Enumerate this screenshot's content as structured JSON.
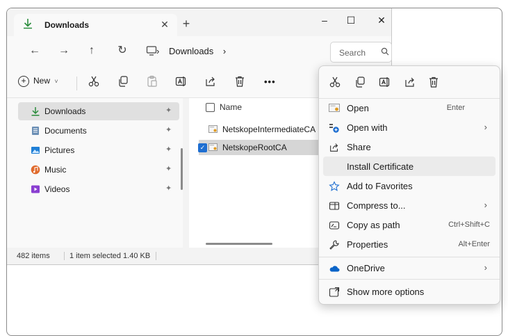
{
  "tab": {
    "title": "Downloads",
    "close": "✕",
    "new_tab": "+"
  },
  "window": {
    "minimize": "–",
    "maximize": "☐",
    "close": "✕"
  },
  "address": {
    "back": "←",
    "forward": "→",
    "up": "↑",
    "refresh": "↻",
    "crumb_sep": "›",
    "crumb_1": "Downloads",
    "crumb_2": "›",
    "search_placeholder": "Search"
  },
  "toolbar": {
    "new_label": "New",
    "new_chevron": "˅",
    "more": "•••"
  },
  "sidebar": {
    "items": [
      {
        "label": "Downloads"
      },
      {
        "label": "Documents"
      },
      {
        "label": "Pictures"
      },
      {
        "label": "Music"
      },
      {
        "label": "Videos"
      }
    ],
    "pin": "✦"
  },
  "content": {
    "column_name": "Name",
    "files": [
      {
        "name": "NetskopeIntermediateCA"
      },
      {
        "name": "NetskopeRootCA"
      }
    ]
  },
  "status": {
    "count": "482 items",
    "selection": "1 item selected  1.40 KB"
  },
  "context_menu": {
    "items": [
      {
        "label": "Open",
        "shortcut": "Enter"
      },
      {
        "label": "Open with",
        "arrow": "›"
      },
      {
        "label": "Share"
      },
      {
        "label": "Install Certificate"
      },
      {
        "label": "Add to Favorites"
      },
      {
        "label": "Compress to...",
        "arrow": "›"
      },
      {
        "label": "Copy as path",
        "shortcut": "Ctrl+Shift+C"
      },
      {
        "label": "Properties",
        "shortcut": "Alt+Enter"
      },
      {
        "label": "OneDrive",
        "arrow": "›"
      },
      {
        "label": "Show more options"
      }
    ]
  },
  "colors": {
    "accent": "#1f6fd1",
    "download_green": "#2a8c3c",
    "onedrive_blue": "#0a64c8"
  }
}
